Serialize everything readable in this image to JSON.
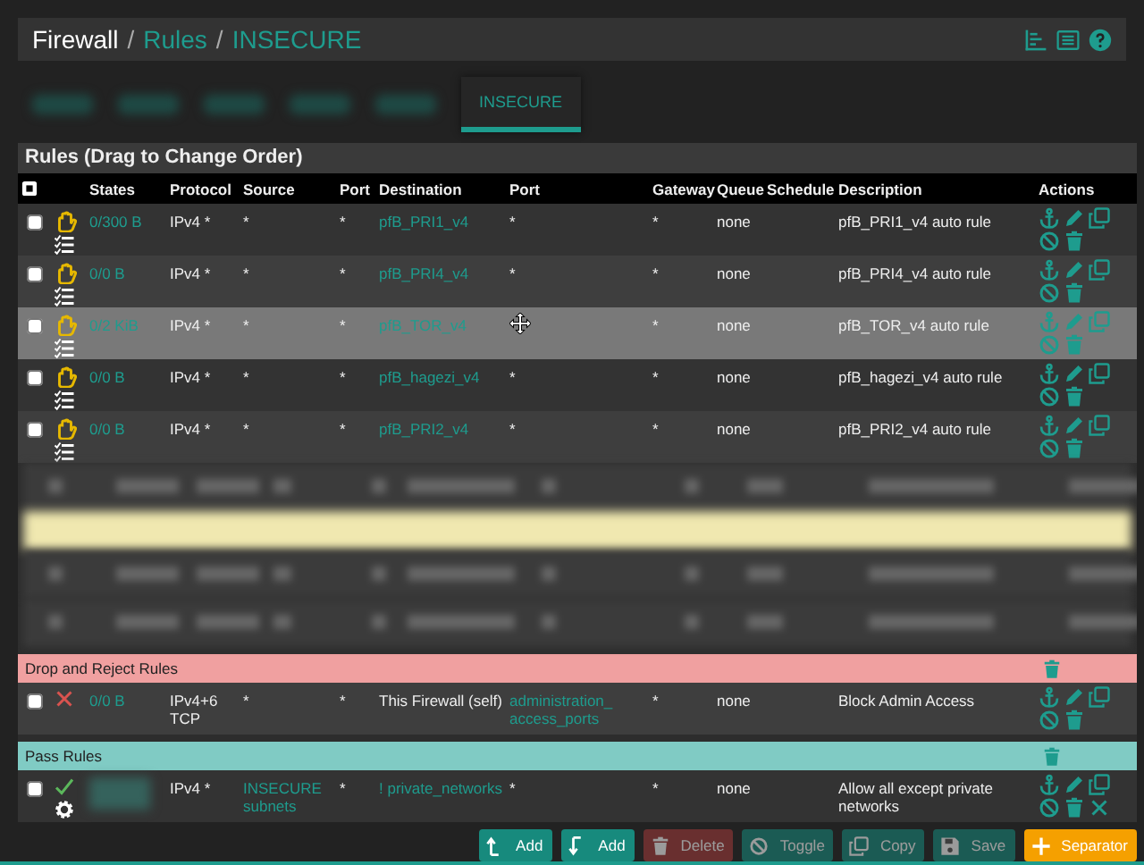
{
  "breadcrumb": [
    {
      "text": "Firewall",
      "kind": "title"
    },
    {
      "text": "/",
      "kind": "separator"
    },
    {
      "text": "Rules",
      "kind": "link"
    },
    {
      "text": "/",
      "kind": "separator"
    },
    {
      "text": "INSECURE",
      "kind": "link"
    }
  ],
  "tabs": [
    {
      "label": "INSECURE",
      "selected": true
    }
  ],
  "panel_title": "Rules (Drag to Change Order)",
  "columns": [
    "States",
    "Protocol",
    "Source",
    "Port",
    "Destination",
    "Port",
    "Gateway",
    "Queue",
    "Schedule",
    "Description",
    "Actions"
  ],
  "rows": [
    {
      "kind": "reject",
      "checked": false,
      "selected": false,
      "removable": false,
      "states": "0/300 B",
      "protocol": "IPv4 *",
      "source": {
        "text": "*",
        "alias": false
      },
      "source_port": "*",
      "destination": {
        "text": "pfB_PRI1_v4",
        "alias": true
      },
      "port": {
        "text": "*",
        "alias": false
      },
      "gateway": "*",
      "queue": "none",
      "description": "pfB_PRI1_v4 auto rule"
    },
    {
      "kind": "reject",
      "checked": false,
      "selected": false,
      "removable": false,
      "states": "0/0 B",
      "protocol": "IPv4 *",
      "source": {
        "text": "*",
        "alias": false
      },
      "source_port": "*",
      "destination": {
        "text": "pfB_PRI4_v4",
        "alias": true
      },
      "port": {
        "text": "*",
        "alias": false
      },
      "gateway": "*",
      "queue": "none",
      "description": "pfB_PRI4_v4 auto rule"
    },
    {
      "kind": "reject",
      "checked": false,
      "selected": true,
      "removable": false,
      "pointer": true,
      "states": "0/2 KiB",
      "protocol": "IPv4 *",
      "source": {
        "text": "*",
        "alias": false
      },
      "source_port": "*",
      "destination": {
        "text": "pfB_TOR_v4",
        "alias": true
      },
      "gateway": "*",
      "queue": "none",
      "description": "pfB_TOR_v4 auto rule"
    },
    {
      "kind": "reject",
      "checked": false,
      "selected": false,
      "removable": false,
      "states": "0/0 B",
      "protocol": "IPv4 *",
      "source": {
        "text": "*",
        "alias": false
      },
      "source_port": "*",
      "destination": {
        "text": "pfB_hagezi_v4",
        "alias": true
      },
      "port": {
        "text": "*",
        "alias": false
      },
      "gateway": "*",
      "queue": "none",
      "description": "pfB_hagezi_v4 auto rule"
    },
    {
      "kind": "reject",
      "checked": false,
      "selected": false,
      "removable": false,
      "states": "0/0 B",
      "protocol": "IPv4 *",
      "source": {
        "text": "*",
        "alias": false
      },
      "source_port": "*",
      "destination": {
        "text": "pfB_PRI2_v4",
        "alias": true
      },
      "port": {
        "text": "*",
        "alias": false
      },
      "gateway": "*",
      "queue": "none",
      "description": "pfB_PRI2_v4 auto rule"
    },
    {
      "kind": "blurred_row"
    },
    {
      "kind": "blurred_separator",
      "color": "#f0e8b0"
    },
    {
      "kind": "blurred_row"
    },
    {
      "kind": "blurred_row"
    },
    {
      "kind": "separator",
      "label": "Drop and Reject Rules",
      "color": "#f0a0a0"
    },
    {
      "kind": "block",
      "checked": false,
      "selected": false,
      "removable": false,
      "states": "0/0 B",
      "protocol": "IPv4+6 TCP",
      "source": {
        "text": "*",
        "alias": false
      },
      "source_port": "*",
      "destination": {
        "text": "This Firewall (self)",
        "alias": false
      },
      "port": {
        "text": "administration_ access_ports",
        "alias": true
      },
      "gateway": "*",
      "queue": "none",
      "description": "Block Admin Access"
    },
    {
      "kind": "separator",
      "label": "Pass Rules",
      "color": "#80cbc4"
    },
    {
      "kind": "pass",
      "checked": false,
      "selected": false,
      "removable": true,
      "states_blurred": true,
      "protocol": "IPv4 *",
      "source": {
        "text": "INSECURE subnets",
        "alias": true
      },
      "source_port": "*",
      "destination": {
        "text": "! private_networks",
        "alias": true
      },
      "port": {
        "text": "*",
        "alias": false
      },
      "gateway": "*",
      "queue": "none",
      "description": "Allow all except private networks"
    }
  ],
  "buttons": [
    {
      "label": "Add",
      "kind": "add_top",
      "disabled": false
    },
    {
      "label": "Add",
      "kind": "add_bottom",
      "disabled": false
    },
    {
      "label": "Delete",
      "kind": "delete",
      "disabled": true
    },
    {
      "label": "Toggle",
      "kind": "toggle",
      "disabled": true
    },
    {
      "label": "Copy",
      "kind": "copy",
      "disabled": true
    },
    {
      "label": "Save",
      "kind": "save",
      "disabled": true
    },
    {
      "label": "Separator",
      "kind": "separator",
      "disabled": false
    }
  ]
}
